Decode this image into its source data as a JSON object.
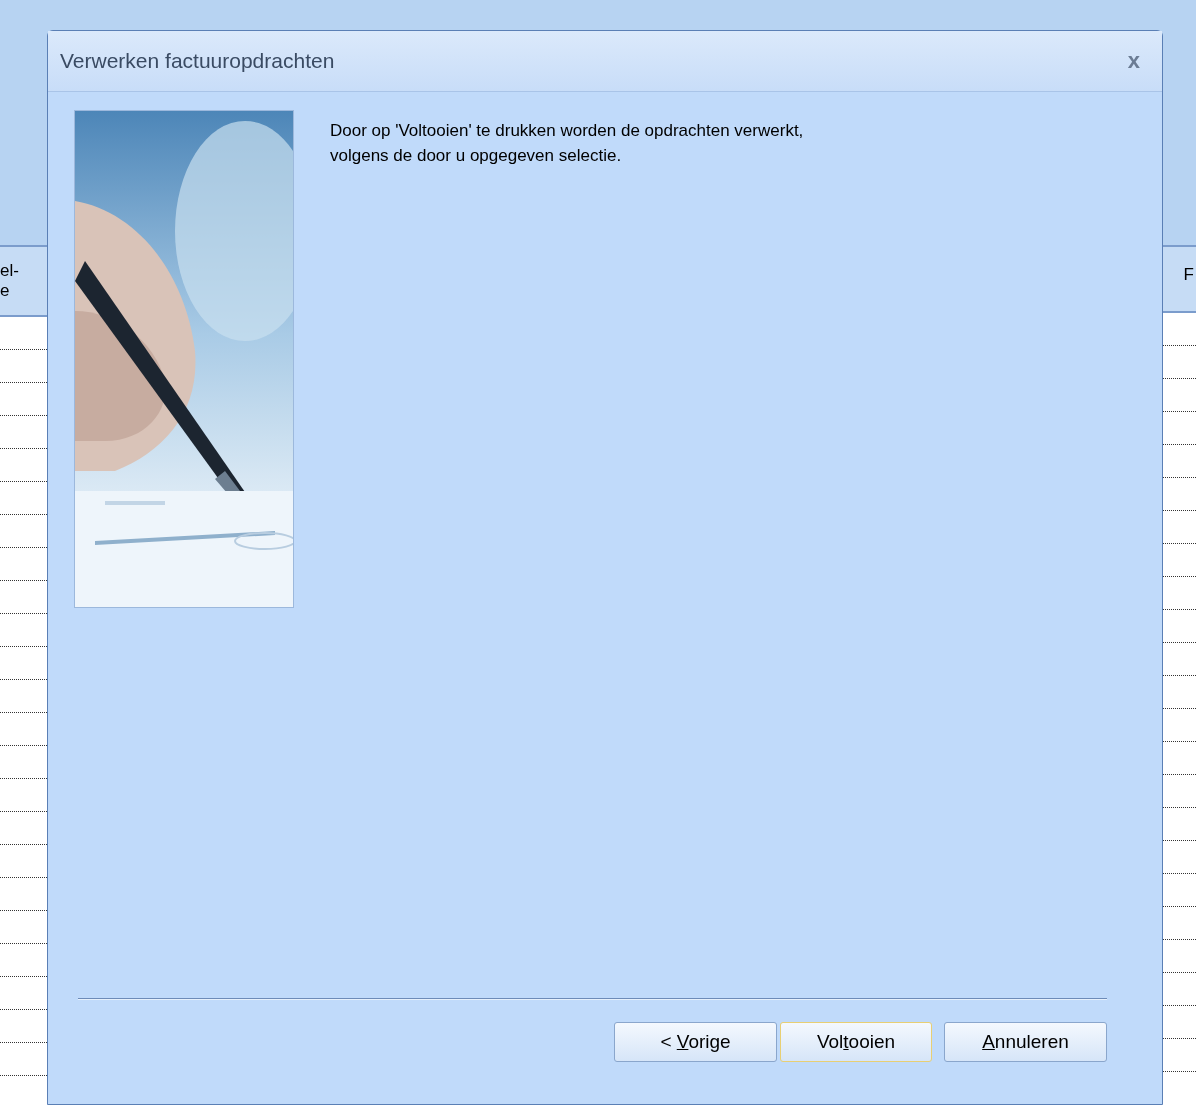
{
  "background": {
    "left_header": [
      "el-",
      "e"
    ],
    "right_header": "F"
  },
  "dialog": {
    "title": "Verwerken factuuropdrachten",
    "close": "x",
    "message": "Door op 'Voltooien' te drukken worden de opdrachten verwerkt, volgens de door u opgegeven selectie.",
    "buttons": [
      {
        "before": "< ",
        "key": "V",
        "after": "orige",
        "default": false
      },
      {
        "before": "Vol",
        "key": "t",
        "after": "ooien",
        "default": true
      },
      {
        "key": "A",
        "after": "nnuleren",
        "default": false
      }
    ]
  }
}
